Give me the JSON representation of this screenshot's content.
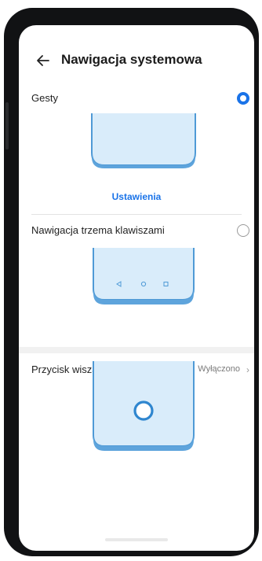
{
  "header": {
    "title": "Nawigacja systemowa",
    "back_icon": "arrow-left-icon"
  },
  "options": {
    "gestures": {
      "label": "Gesty",
      "selected": true
    },
    "settings_link": "Ustawienia",
    "three_keys": {
      "label": "Nawigacja trzema klawiszami",
      "selected": false
    },
    "floating_button": {
      "label": "Przycisk wiszący",
      "value": "Wyłączono"
    }
  },
  "colors": {
    "accent": "#1a73e8",
    "illustration_fill": "#d9ecfa",
    "illustration_stroke": "#4f9ad6"
  }
}
